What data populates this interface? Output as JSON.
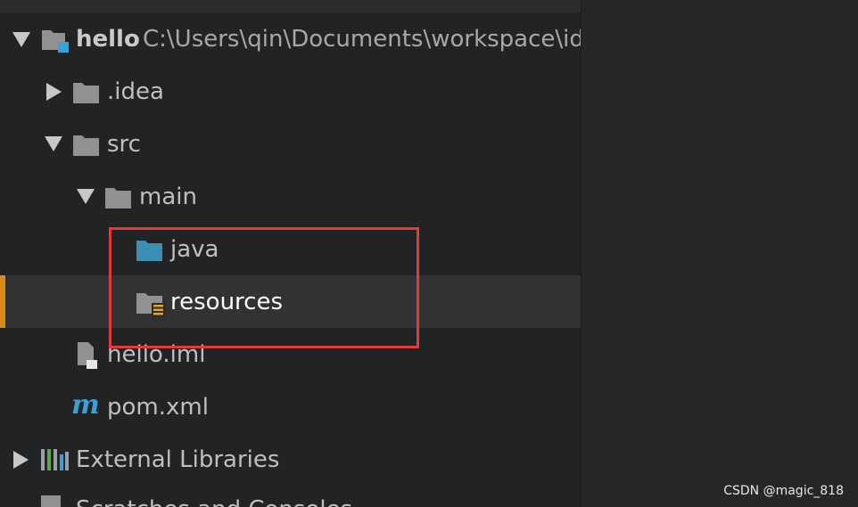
{
  "project": {
    "name": "hello",
    "path": "C:\\Users\\qin\\Documents\\workspace\\idea"
  },
  "tree": {
    "idea_folder": ".idea",
    "src_folder": "src",
    "main_folder": "main",
    "java_folder": "java",
    "resources_folder": "resources",
    "iml_file": "hello.iml",
    "pom_file": "pom.xml",
    "pom_icon_letter": "m",
    "external_libraries": "External Libraries",
    "scratches": "Scratches and Consoles"
  },
  "colors": {
    "selection_accent": "#d98c1c",
    "java_folder": "#3a8fb5",
    "highlight_border": "#e03b3b"
  },
  "watermark": "CSDN @magic_818"
}
